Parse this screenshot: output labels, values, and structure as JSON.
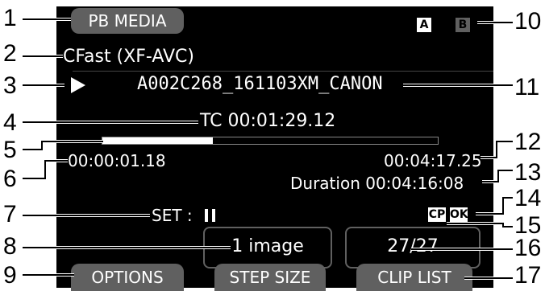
{
  "callout_numbers": [
    "1",
    "2",
    "3",
    "4",
    "5",
    "6",
    "7",
    "8",
    "9",
    "10",
    "11",
    "12",
    "13",
    "14",
    "15",
    "16",
    "17"
  ],
  "screen": {
    "mode_label": "PB MEDIA",
    "media_type": "CFast (XF-AVC)",
    "play_icon": "play-icon",
    "clip_name": "A002C268_161103XM_CANON",
    "timecode": "TC 00:01:29.12",
    "progress_fraction": 0.33,
    "elapsed_time": "00:00:01.18",
    "total_time": "00:04:17.25",
    "duration_label": "Duration",
    "duration_value": "00:04:16:08",
    "set_label": "SET :",
    "pause_icon": "pause-icon",
    "step_size_value": "1 image",
    "clip_counter": "27/27",
    "options_label": "OPTIONS",
    "step_size_label": "STEP SIZE",
    "clip_list_label": "CLIP LIST",
    "slot_a": "A",
    "slot_b": "B",
    "cp_badge": "CP",
    "ok_badge": "OK"
  },
  "colors": {
    "screen_bg": "#000000",
    "button_bg": "#606060",
    "text": "#ffffff",
    "slot_a_bg": "#ffffff",
    "slot_b_bg": "#606060"
  }
}
